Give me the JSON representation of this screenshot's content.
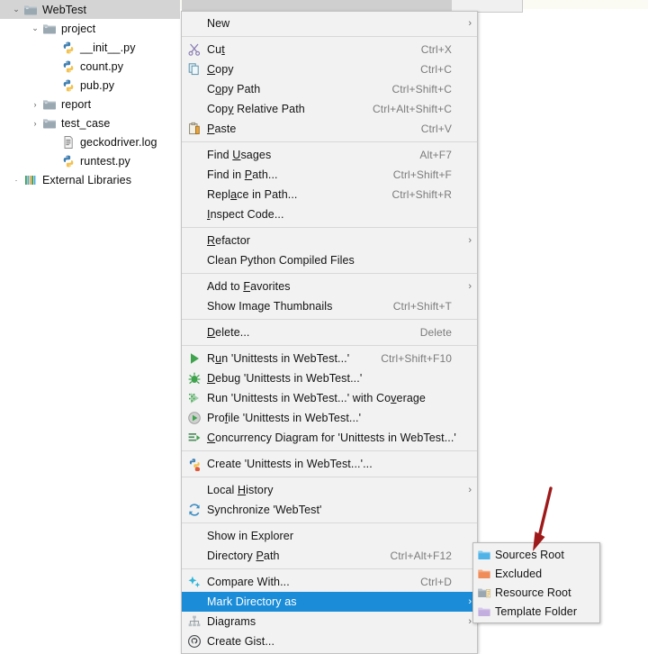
{
  "tree": {
    "items": [
      {
        "label": "WebTest",
        "icon": "folder-icon",
        "indent": 0,
        "arrow": "expanded",
        "selected": true
      },
      {
        "label": "project",
        "icon": "folder-icon",
        "indent": 1,
        "arrow": "expanded",
        "selected": false
      },
      {
        "label": "__init__.py",
        "icon": "python-file-icon",
        "indent": 2,
        "arrow": "none",
        "selected": false
      },
      {
        "label": "count.py",
        "icon": "python-file-icon",
        "indent": 2,
        "arrow": "none",
        "selected": false
      },
      {
        "label": "pub.py",
        "icon": "python-file-icon",
        "indent": 2,
        "arrow": "none",
        "selected": false
      },
      {
        "label": "report",
        "icon": "folder-icon",
        "indent": 1,
        "arrow": "collapsed",
        "selected": false
      },
      {
        "label": "test_case",
        "icon": "folder-icon",
        "indent": 1,
        "arrow": "collapsed",
        "selected": false
      },
      {
        "label": "geckodriver.log",
        "icon": "log-file-icon",
        "indent": 2,
        "arrow": "none",
        "selected": false
      },
      {
        "label": "runtest.py",
        "icon": "python-file-icon",
        "indent": 2,
        "arrow": "none",
        "selected": false
      },
      {
        "label": "External Libraries",
        "icon": "library-icon",
        "indent": 0,
        "arrow": "collapsed-small",
        "selected": false
      }
    ]
  },
  "context_menu": {
    "items": [
      {
        "label": "New",
        "mnemonic": "",
        "accel": "",
        "icon": "none",
        "submenu": true,
        "highlighted": false,
        "separator_after": true
      },
      {
        "label": "Cut",
        "mnemonic": "t",
        "accel": "Ctrl+X",
        "icon": "scissors-icon",
        "submenu": false,
        "highlighted": false,
        "separator_after": false
      },
      {
        "label": "Copy",
        "mnemonic": "C",
        "accel": "Ctrl+C",
        "icon": "copy-icon",
        "submenu": false,
        "highlighted": false,
        "separator_after": false
      },
      {
        "label": "Copy Path",
        "mnemonic": "o",
        "accel": "Ctrl+Shift+C",
        "icon": "none",
        "submenu": false,
        "highlighted": false,
        "separator_after": false
      },
      {
        "label": "Copy Relative Path",
        "mnemonic": "y",
        "accel": "Ctrl+Alt+Shift+C",
        "icon": "none",
        "submenu": false,
        "highlighted": false,
        "separator_after": false
      },
      {
        "label": "Paste",
        "mnemonic": "P",
        "accel": "Ctrl+V",
        "icon": "paste-icon",
        "submenu": false,
        "highlighted": false,
        "separator_after": true
      },
      {
        "label": "Find Usages",
        "mnemonic": "U",
        "accel": "Alt+F7",
        "icon": "none",
        "submenu": false,
        "highlighted": false,
        "separator_after": false
      },
      {
        "label": "Find in Path...",
        "mnemonic": "P",
        "accel": "Ctrl+Shift+F",
        "icon": "none",
        "submenu": false,
        "highlighted": false,
        "separator_after": false
      },
      {
        "label": "Replace in Path...",
        "mnemonic": "a",
        "accel": "Ctrl+Shift+R",
        "icon": "none",
        "submenu": false,
        "highlighted": false,
        "separator_after": false
      },
      {
        "label": "Inspect Code...",
        "mnemonic": "I",
        "accel": "",
        "icon": "none",
        "submenu": false,
        "highlighted": false,
        "separator_after": true
      },
      {
        "label": "Refactor",
        "mnemonic": "R",
        "accel": "",
        "icon": "none",
        "submenu": true,
        "highlighted": false,
        "separator_after": false
      },
      {
        "label": "Clean Python Compiled Files",
        "mnemonic": "",
        "accel": "",
        "icon": "none",
        "submenu": false,
        "highlighted": false,
        "separator_after": true
      },
      {
        "label": "Add to Favorites",
        "mnemonic": "F",
        "accel": "",
        "icon": "none",
        "submenu": true,
        "highlighted": false,
        "separator_after": false
      },
      {
        "label": "Show Image Thumbnails",
        "mnemonic": "",
        "accel": "Ctrl+Shift+T",
        "icon": "none",
        "submenu": false,
        "highlighted": false,
        "separator_after": true
      },
      {
        "label": "Delete...",
        "mnemonic": "D",
        "accel": "Delete",
        "icon": "none",
        "submenu": false,
        "highlighted": false,
        "separator_after": true
      },
      {
        "label": "Run 'Unittests in WebTest...'",
        "mnemonic": "u",
        "accel": "Ctrl+Shift+F10",
        "icon": "run-icon",
        "submenu": false,
        "highlighted": false,
        "separator_after": false
      },
      {
        "label": "Debug 'Unittests in WebTest...'",
        "mnemonic": "D",
        "accel": "",
        "icon": "debug-icon",
        "submenu": false,
        "highlighted": false,
        "separator_after": false
      },
      {
        "label": "Run 'Unittests in WebTest...' with Coverage",
        "mnemonic": "v",
        "accel": "",
        "icon": "coverage-icon",
        "submenu": false,
        "highlighted": false,
        "separator_after": false
      },
      {
        "label": "Profile 'Unittests in WebTest...'",
        "mnemonic": "f",
        "accel": "",
        "icon": "profile-icon",
        "submenu": false,
        "highlighted": false,
        "separator_after": false
      },
      {
        "label": "Concurrency Diagram for 'Unittests in WebTest...'",
        "mnemonic": "C",
        "accel": "",
        "icon": "concurrency-icon",
        "submenu": false,
        "highlighted": false,
        "separator_after": true
      },
      {
        "label": "Create 'Unittests in WebTest...'...",
        "mnemonic": "",
        "accel": "",
        "icon": "create-config-icon",
        "submenu": false,
        "highlighted": false,
        "separator_after": true
      },
      {
        "label": "Local History",
        "mnemonic": "H",
        "accel": "",
        "icon": "none",
        "submenu": true,
        "highlighted": false,
        "separator_after": false
      },
      {
        "label": "Synchronize 'WebTest'",
        "mnemonic": "",
        "accel": "",
        "icon": "sync-icon",
        "submenu": false,
        "highlighted": false,
        "separator_after": true
      },
      {
        "label": "Show in Explorer",
        "mnemonic": "",
        "accel": "",
        "icon": "none",
        "submenu": false,
        "highlighted": false,
        "separator_after": false
      },
      {
        "label": "Directory Path",
        "mnemonic": "P",
        "accel": "Ctrl+Alt+F12",
        "icon": "none",
        "submenu": false,
        "highlighted": false,
        "separator_after": true
      },
      {
        "label": "Compare With...",
        "mnemonic": "",
        "accel": "Ctrl+D",
        "icon": "compare-icon",
        "submenu": false,
        "highlighted": false,
        "separator_after": false
      },
      {
        "label": "Mark Directory as",
        "mnemonic": "",
        "accel": "",
        "icon": "none",
        "submenu": true,
        "highlighted": true,
        "separator_after": false
      },
      {
        "label": "Diagrams",
        "mnemonic": "",
        "accel": "",
        "icon": "diagram-icon",
        "submenu": true,
        "highlighted": false,
        "separator_after": false
      },
      {
        "label": "Create Gist...",
        "mnemonic": "",
        "accel": "",
        "icon": "gist-icon",
        "submenu": false,
        "highlighted": false,
        "separator_after": false
      }
    ]
  },
  "submenu": {
    "items": [
      {
        "label": "Sources Root",
        "icon": "sources-root-folder-icon",
        "color": "#4fb3e8"
      },
      {
        "label": "Excluded",
        "icon": "excluded-folder-icon",
        "color": "#f08b5a"
      },
      {
        "label": "Resource Root",
        "icon": "resource-root-folder-icon",
        "color": "#9aa7b0"
      },
      {
        "label": "Template Folder",
        "icon": "template-folder-icon",
        "color": "#c3aee0"
      }
    ]
  },
  "annotation": {
    "arrow_color": "#9e1a1a",
    "points_to": "Sources Root"
  },
  "colors": {
    "highlight": "#1a8cd8",
    "menu_bg": "#f2f2f2",
    "tree_selection": "#d4d4d4",
    "accel_text": "#7b7b7b"
  }
}
